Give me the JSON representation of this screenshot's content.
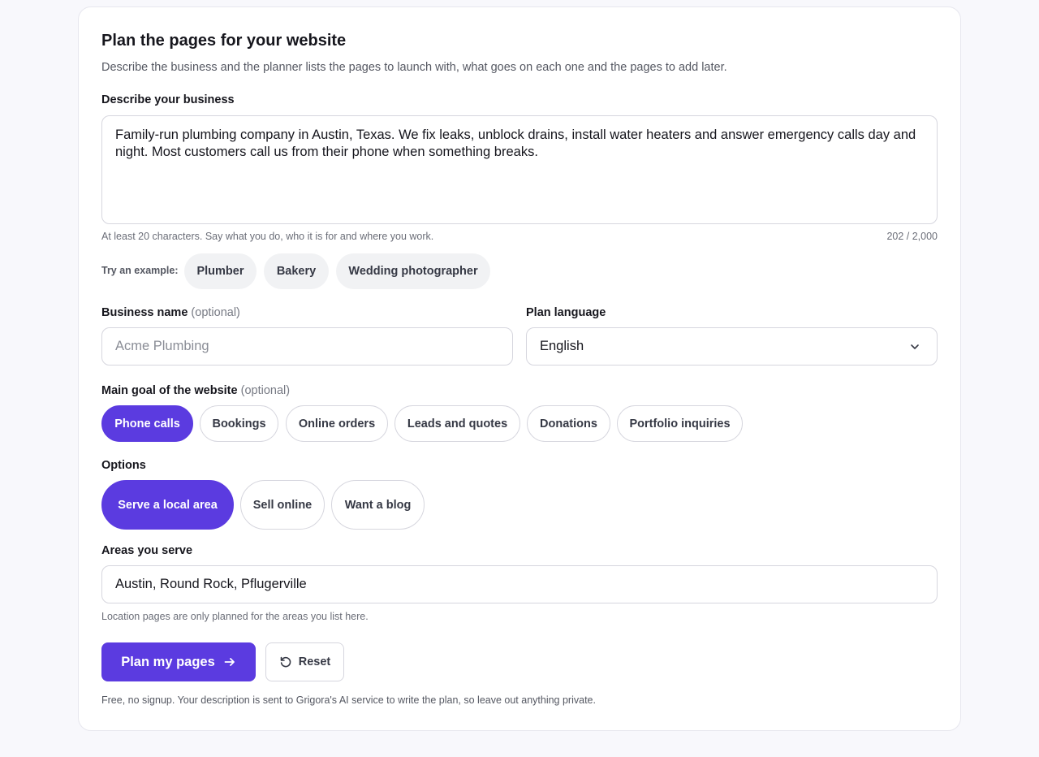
{
  "planner": {
    "title": "Plan the pages for your website",
    "subtitle": "Describe the business and the planner lists the pages to launch with, what goes on each one and the pages to add later."
  },
  "description": {
    "label": "Describe your business",
    "value": "Family-run plumbing company in Austin, Texas. We fix leaks, unblock drains, install water heaters and answer emergency calls day and night. Most customers call us from their phone when something breaks.",
    "hint": "At least 20 characters. Say what you do, who it is for and where you work.",
    "counter": "202 / 2,000"
  },
  "examples": {
    "label": "Try an example:",
    "items": [
      "Plumber",
      "Bakery",
      "Wedding photographer"
    ]
  },
  "business_name": {
    "label": "Business name",
    "optional": "(optional)",
    "placeholder": "Acme Plumbing"
  },
  "language": {
    "label": "Plan language",
    "value": "English"
  },
  "goal": {
    "label": "Main goal of the website",
    "optional": "(optional)",
    "items": [
      "Phone calls",
      "Bookings",
      "Online orders",
      "Leads and quotes",
      "Donations",
      "Portfolio inquiries"
    ],
    "selected": "Phone calls"
  },
  "options": {
    "label": "Options",
    "items": [
      "Serve a local area",
      "Sell online",
      "Want a blog"
    ],
    "selected": "Serve a local area"
  },
  "areas": {
    "label": "Areas you serve",
    "value": "Austin, Round Rock, Pflugerville",
    "hint": "Location pages are only planned for the areas you list here."
  },
  "actions": {
    "primary": "Plan my pages",
    "secondary": "Reset"
  },
  "footer": "Free, no signup. Your description is sent to Grigora's AI service to write the plan, so leave out anything private.",
  "colors": {
    "accent": "#5b3be0",
    "background": "#f8f8fc"
  }
}
